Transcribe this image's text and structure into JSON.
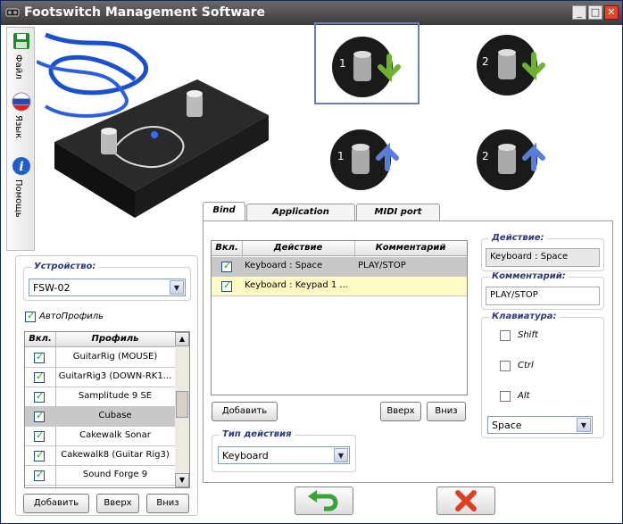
{
  "window": {
    "title": "Footswitch Management Software"
  },
  "sidebar": {
    "items": [
      {
        "label": "Файл",
        "icon": "save-icon"
      },
      {
        "label": "Язык",
        "icon": "language-icon"
      },
      {
        "label": "Помощь",
        "icon": "info-icon"
      }
    ]
  },
  "device": {
    "group_label": "Устройство:",
    "selected": "FSW-02",
    "autoprofile_label": "АвтоПрофиль",
    "autoprofile_checked": true
  },
  "profiles": {
    "headers": [
      "Вкл.",
      "Профиль"
    ],
    "rows": [
      {
        "enabled": true,
        "name": "GuitarRig (MOUSE)"
      },
      {
        "enabled": true,
        "name": "GuitarRig3 (DOWN-RK1..."
      },
      {
        "enabled": true,
        "name": "Samplitude 9 SE"
      },
      {
        "enabled": true,
        "name": "Cubase",
        "selected": true
      },
      {
        "enabled": true,
        "name": "Cakewalk Sonar"
      },
      {
        "enabled": true,
        "name": "Cakewalk8 (Guitar Rig3)"
      },
      {
        "enabled": true,
        "name": "Sound Forge 9"
      }
    ],
    "add_label": "Добавить",
    "up_label": "Вверх",
    "down_label": "Вниз"
  },
  "tabs": [
    "Bind",
    "Application AutoSwitch",
    "MIDI port settings"
  ],
  "bind": {
    "headers": [
      "Вкл.",
      "Действие",
      "Комментарий"
    ],
    "rows": [
      {
        "enabled": true,
        "action": "Keyboard : Space",
        "comment": "PLAY/STOP"
      },
      {
        "enabled": true,
        "action": "Keyboard : Keypad 1 ...",
        "comment": ""
      }
    ],
    "add_label": "Добавить",
    "up_label": "Вверх",
    "down_label": "Вниз",
    "action_type_label": "Тип действия",
    "action_type": "Keyboard"
  },
  "details": {
    "action_label": "Действие:",
    "action_value": "Keyboard : Space",
    "comment_label": "Комментарий:",
    "comment_value": "PLAY/STOP",
    "keyboard_label": "Клавиатура:",
    "shift_label": "Shift",
    "ctrl_label": "Ctrl",
    "alt_label": "Alt",
    "key_value": "Space"
  },
  "colors": {
    "accent": "#2d3a7a",
    "selected_row": "#c8c8c8",
    "highlight_row": "#fffbc4",
    "ok_green": "#3aa23a",
    "cancel_red": "#e04020"
  }
}
